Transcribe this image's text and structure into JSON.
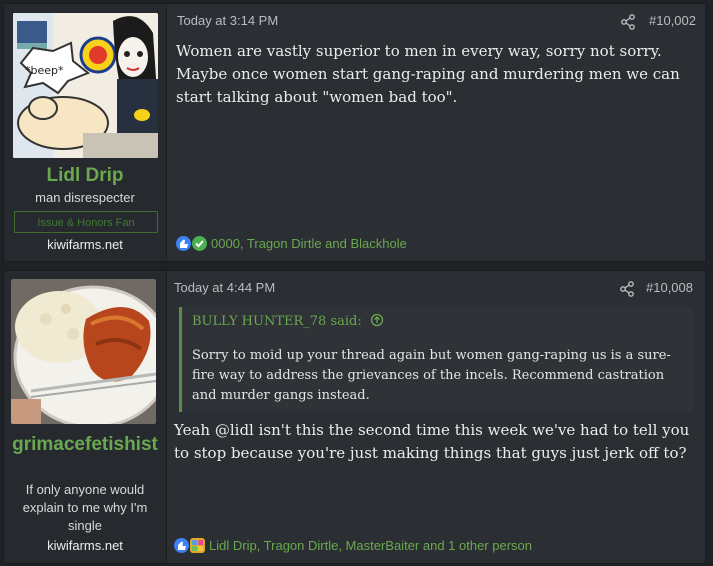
{
  "posts": [
    {
      "username": "Lidl Drip",
      "user_title": "man disrespecter",
      "banner": "Issue & Honors Fan",
      "site": "kiwifarms.net",
      "timestamp": "Today at 3:14 PM",
      "post_number": "#10,002",
      "avatar_caption": "*beep*",
      "avatar_brand": "Lidl",
      "body": "Women are vastly superior to men in every way, sorry not sorry. Maybe once women start gang-raping and murdering men we can start talking about \"women bad too\".",
      "reactions": "0000, Tragon Dirtle and Blackhole"
    },
    {
      "username": "grimacefetishist",
      "user_title": "If only anyone would explain to me why I'm single",
      "site": "kiwifarms.net",
      "timestamp": "Today at 4:44 PM",
      "post_number": "#10,008",
      "quote": {
        "author": "BULLY HUNTER_78 said:",
        "text": "Sorry to moid up your thread again but women gang-raping us is a sure-fire way to address the grievances of the incels. Recommend castration and murder gangs instead."
      },
      "body": "Yeah @lidl isn't this the second time this week we've had to tell you to stop because you're just making things that guys just jerk off to?",
      "reactions": "Lidl Drip, Tragon Dirtle, MasterBaiter and 1 other person"
    }
  ],
  "colors": {
    "accent": "#6aa84f",
    "post_bg": "#2b2e33",
    "user_bg": "#262a2f",
    "text": "#ececec"
  }
}
